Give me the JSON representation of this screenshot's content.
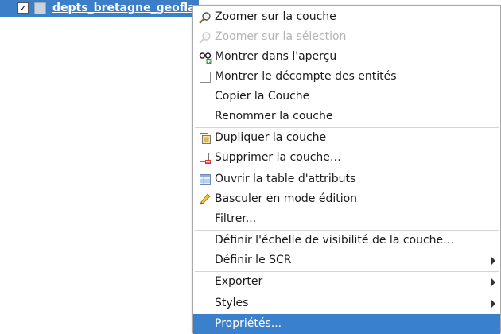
{
  "layer_tree": {
    "checked_mark": "✓",
    "layer_name": "depts_bretagne_geofla"
  },
  "menu": {
    "items": [
      {
        "label": "Zoomer sur la couche",
        "icon": "zoom-layer-icon"
      },
      {
        "label": "Zoomer sur la sélection",
        "icon": "zoom-selection-icon",
        "disabled": true
      },
      {
        "label": "Montrer dans l'aperçu",
        "icon": "overview-icon"
      },
      {
        "label": "Montrer le décompte des entités",
        "icon": "checkbox-icon"
      },
      {
        "label": "Copier la Couche"
      },
      {
        "label": "Renommer la couche"
      },
      {
        "label": "Dupliquer la couche",
        "icon": "duplicate-layer-icon"
      },
      {
        "label": "Supprimer la couche…",
        "icon": "remove-layer-icon"
      },
      {
        "label": "Ouvrir la table d'attributs",
        "icon": "attribute-table-icon"
      },
      {
        "label": "Basculer en mode édition",
        "icon": "pencil-icon"
      },
      {
        "label": "Filtrer..."
      },
      {
        "label": "Définir l'échelle de visibilité de la couche…"
      },
      {
        "label": "Définir le SCR",
        "submenu": true
      },
      {
        "label": "Exporter",
        "submenu": true
      },
      {
        "label": "Styles",
        "submenu": true
      },
      {
        "label": "Propriétés...",
        "selected": true
      }
    ]
  },
  "colors": {
    "selection": "#3b80cc",
    "layer_highlight": "#3c7fc8",
    "disabled_text": "#b4b4b4"
  }
}
